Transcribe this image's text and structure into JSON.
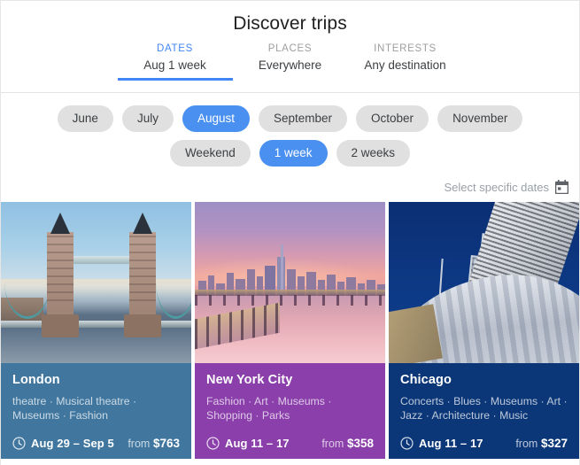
{
  "header": {
    "title": "Discover trips",
    "tabs": [
      {
        "label": "DATES",
        "value": "Aug 1 week",
        "active": true
      },
      {
        "label": "PLACES",
        "value": "Everywhere",
        "active": false
      },
      {
        "label": "INTERESTS",
        "value": "Any destination",
        "active": false
      }
    ]
  },
  "filters": {
    "months": [
      {
        "label": "June",
        "selected": false
      },
      {
        "label": "July",
        "selected": false
      },
      {
        "label": "August",
        "selected": true
      },
      {
        "label": "September",
        "selected": false
      },
      {
        "label": "October",
        "selected": false
      },
      {
        "label": "November",
        "selected": false
      }
    ],
    "durations": [
      {
        "label": "Weekend",
        "selected": false
      },
      {
        "label": "1 week",
        "selected": true
      },
      {
        "label": "2 weeks",
        "selected": false
      }
    ],
    "specific_dates_label": "Select specific dates",
    "calendar_icon": "calendar-icon"
  },
  "colors": {
    "accent_blue": "#4285f4",
    "chip_selected": "#4a90f0",
    "chip_default": "#e0e0e0",
    "london_footer": "#41779f",
    "nyc_footer": "#8a3faa",
    "chicago_footer": "#0b3778"
  },
  "cards": [
    {
      "city": "London",
      "tags": "theatre · Musical theatre · Museums · Fashion",
      "dates": "Aug 29 – Sep 5",
      "price_from_label": "from",
      "price": "$763",
      "footer_color": "#41779f",
      "photo": "tower-bridge-photo",
      "clock_icon": "clock-icon"
    },
    {
      "city": "New York City",
      "tags": "Fashion · Art · Museums · Shopping · Parks",
      "dates": "Aug 11 – 17",
      "price_from_label": "from",
      "price": "$358",
      "footer_color": "#8a3faa",
      "photo": "manhattan-skyline-photo",
      "clock_icon": "clock-icon"
    },
    {
      "city": "Chicago",
      "tags": "Concerts · Blues · Museums · Art · Jazz · Architecture · Music",
      "dates": "Aug 11 – 17",
      "price_from_label": "from",
      "price": "$327",
      "footer_color": "#0b3778",
      "photo": "chicago-architecture-photo",
      "clock_icon": "clock-icon"
    }
  ]
}
